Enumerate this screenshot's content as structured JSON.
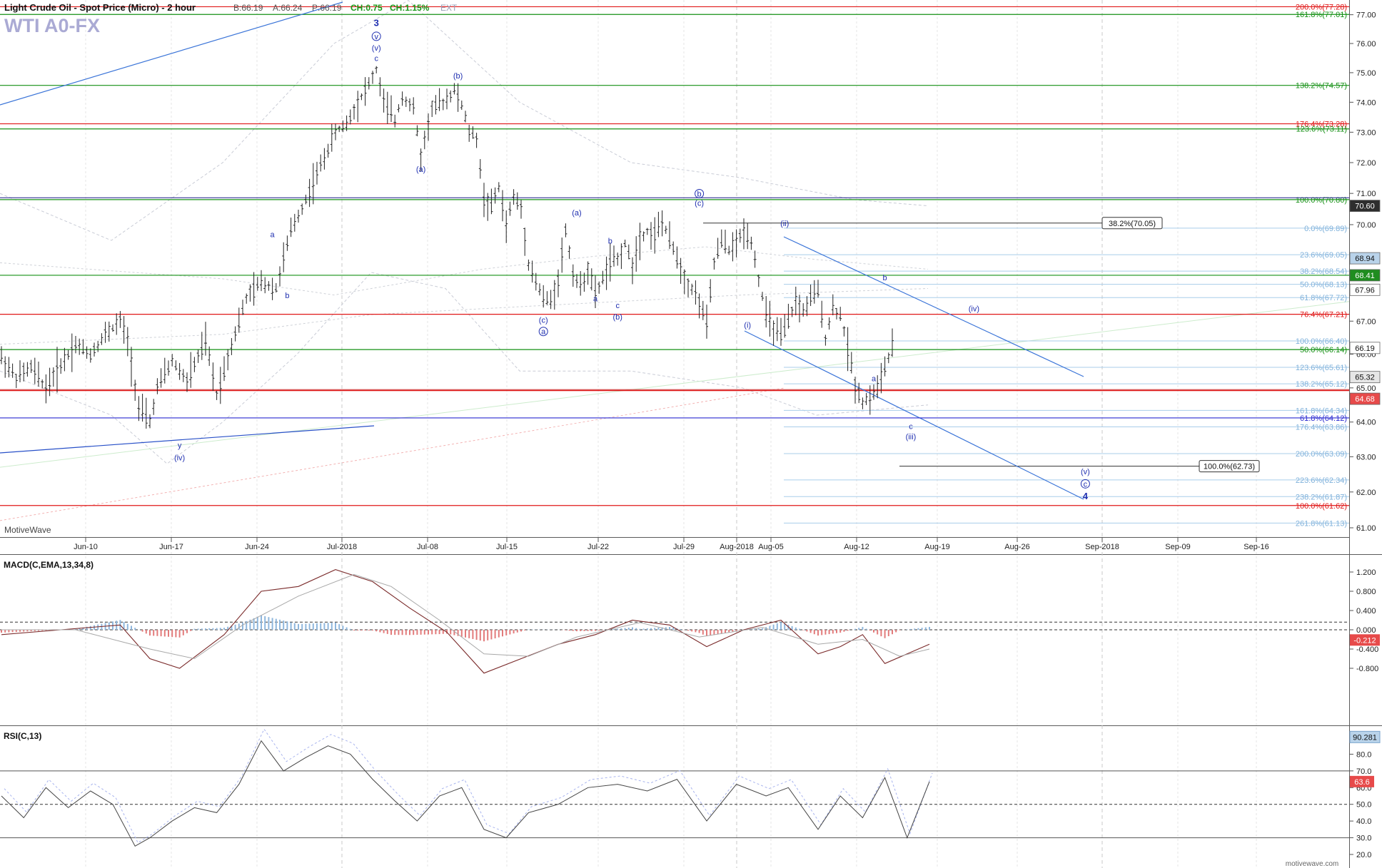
{
  "header": {
    "title": "Light Crude Oil - Spot Price (Micro) - 2 hour",
    "bid": "B:66.19",
    "ask": "A:66.24",
    "price": "P:66.19",
    "change": "CH:0.75",
    "change_pct": "CH:1.15%",
    "ext": "EXT",
    "symbol": "WTI A0-FX",
    "watermark": "MotiveWave",
    "footer_logo": "motivewave.com"
  },
  "colors": {
    "price_bars": "#222222",
    "up_text": "#1a9a1a",
    "wave_labels": "#1f2fb0",
    "fib_red": "#e01818",
    "fib_green": "#159015",
    "fib_lightblue": "#a9cdea",
    "trend_blue": "#3a74d8",
    "macd_hist_pos": "#8fb7dd",
    "macd_hist_neg": "#e27b7b"
  },
  "chart_data": [
    {
      "type": "candlestick",
      "title": "Light Crude Oil - Spot Price (Micro) - 2 hour",
      "x_tick_labels": [
        "Jun-10",
        "Jun-17",
        "Jun-24",
        "Jul-2018",
        "Jul-08",
        "Jul-15",
        "Jul-22",
        "Jul-29",
        "Aug-2018",
        "Aug-05",
        "Aug-12",
        "Aug-19",
        "Aug-26",
        "Sep-2018",
        "Sep-09",
        "Sep-16"
      ],
      "y_ticks": [
        "77.00",
        "76.00",
        "75.00",
        "74.00",
        "73.00",
        "72.00",
        "71.00",
        "70.00",
        "67.00",
        "66.00",
        "65.00",
        "64.00",
        "63.00",
        "62.00",
        "61.00"
      ],
      "ylim": [
        60.5,
        77.6
      ],
      "grid": true,
      "scale": "log",
      "price_path": [
        [
          0,
          65.9
        ],
        [
          4,
          65.3
        ],
        [
          8,
          65.6
        ],
        [
          12,
          65.0
        ],
        [
          16,
          65.7
        ],
        [
          20,
          66.3
        ],
        [
          24,
          66.0
        ],
        [
          28,
          66.6
        ],
        [
          32,
          67.0
        ],
        [
          34,
          66.4
        ],
        [
          37,
          64.4
        ],
        [
          40,
          64.0
        ],
        [
          42,
          65.0
        ],
        [
          46,
          65.8
        ],
        [
          50,
          65.2
        ],
        [
          55,
          66.4
        ],
        [
          58,
          64.8
        ],
        [
          62,
          66.3
        ],
        [
          66,
          67.7
        ],
        [
          70,
          68.2
        ],
        [
          74,
          68.0
        ],
        [
          78,
          69.8
        ],
        [
          82,
          70.8
        ],
        [
          86,
          71.9
        ],
        [
          90,
          73.0
        ],
        [
          93,
          73.3
        ],
        [
          96,
          74.0
        ],
        [
          99,
          74.6
        ],
        [
          101,
          75.1
        ],
        [
          103,
          74.0
        ],
        [
          106,
          73.4
        ],
        [
          108,
          74.2
        ],
        [
          111,
          73.8
        ],
        [
          113,
          72.2
        ],
        [
          116,
          73.8
        ],
        [
          119,
          74.0
        ],
        [
          122,
          74.4
        ],
        [
          124,
          73.9
        ],
        [
          126,
          73.0
        ],
        [
          128,
          72.8
        ],
        [
          130,
          70.8
        ],
        [
          132,
          70.6
        ],
        [
          134,
          71.2
        ],
        [
          136,
          70.0
        ],
        [
          138,
          70.9
        ],
        [
          140,
          70.5
        ],
        [
          142,
          68.8
        ],
        [
          144,
          68.2
        ],
        [
          146,
          67.7
        ],
        [
          148,
          67.6
        ],
        [
          150,
          68.3
        ],
        [
          152,
          69.8
        ],
        [
          154,
          68.5
        ],
        [
          156,
          68.0
        ],
        [
          158,
          68.6
        ],
        [
          160,
          67.8
        ],
        [
          162,
          68.3
        ],
        [
          164,
          68.8
        ],
        [
          166,
          68.9
        ],
        [
          168,
          69.4
        ],
        [
          170,
          68.7
        ],
        [
          172,
          69.6
        ],
        [
          174,
          69.8
        ],
        [
          176,
          69.7
        ],
        [
          178,
          70.1
        ],
        [
          180,
          69.5
        ],
        [
          182,
          69.0
        ],
        [
          184,
          68.3
        ],
        [
          186,
          68.0
        ],
        [
          188,
          67.6
        ],
        [
          190,
          66.9
        ],
        [
          192,
          68.8
        ],
        [
          194,
          69.5
        ],
        [
          196,
          69.2
        ],
        [
          198,
          69.4
        ],
        [
          200,
          69.8
        ],
        [
          202,
          69.5
        ],
        [
          204,
          68.3
        ],
        [
          206,
          67.2
        ],
        [
          208,
          66.8
        ],
        [
          210,
          66.5
        ],
        [
          212,
          67.0
        ],
        [
          214,
          67.6
        ],
        [
          216,
          67.3
        ],
        [
          218,
          67.7
        ],
        [
          220,
          67.9
        ],
        [
          222,
          66.5
        ],
        [
          224,
          67.4
        ],
        [
          226,
          67.2
        ],
        [
          228,
          66.2
        ],
        [
          230,
          65.1
        ],
        [
          232,
          64.6
        ],
        [
          234,
          64.7
        ],
        [
          236,
          65.0
        ],
        [
          238,
          65.6
        ],
        [
          240,
          66.19
        ]
      ],
      "wave_labels": [
        {
          "text": "3",
          "x": 101,
          "y": 76.6,
          "size": "large"
        },
        {
          "text": "v",
          "x": 101,
          "y": 76.15,
          "circled": true
        },
        {
          "text": "(v)",
          "x": 101,
          "y": 75.75
        },
        {
          "text": "c",
          "x": 101,
          "y": 75.4
        },
        {
          "text": "(b)",
          "x": 123,
          "y": 74.8
        },
        {
          "text": "(a)",
          "x": 113,
          "y": 71.7
        },
        {
          "text": "a",
          "x": 73,
          "y": 69.6
        },
        {
          "text": "b",
          "x": 77,
          "y": 67.7
        },
        {
          "text": "y",
          "x": 48,
          "y": 63.25
        },
        {
          "text": "(iv)",
          "x": 48,
          "y": 62.9
        },
        {
          "text": "(a)",
          "x": 155,
          "y": 70.3
        },
        {
          "text": "b",
          "x": 164,
          "y": 69.4
        },
        {
          "text": "a",
          "x": 160,
          "y": 67.6
        },
        {
          "text": "c",
          "x": 166,
          "y": 67.4
        },
        {
          "text": "(b)",
          "x": 166,
          "y": 67.05
        },
        {
          "text": "(c)",
          "x": 146,
          "y": 66.95
        },
        {
          "text": "a",
          "x": 146,
          "y": 66.6,
          "circled": true
        },
        {
          "text": "b",
          "x": 188,
          "y": 70.9,
          "circled": true
        },
        {
          "text": "(c)",
          "x": 188,
          "y": 70.6
        },
        {
          "text": "(ii)",
          "x": 211,
          "y": 69.95
        },
        {
          "text": "(i)",
          "x": 201,
          "y": 66.8
        },
        {
          "text": "b",
          "x": 238,
          "y": 68.25
        },
        {
          "text": "a",
          "x": 235,
          "y": 65.2
        },
        {
          "text": "(iv)",
          "x": 262,
          "y": 67.3
        },
        {
          "text": "c",
          "x": 245,
          "y": 63.8
        },
        {
          "text": "(iii)",
          "x": 245,
          "y": 63.5
        },
        {
          "text": "(v)",
          "x": 292,
          "y": 62.5
        },
        {
          "text": "c",
          "x": 292,
          "y": 62.15,
          "circled": true
        },
        {
          "text": "4",
          "x": 292,
          "y": 61.8,
          "size": "large"
        }
      ],
      "fib_levels": [
        {
          "price": 77.28,
          "label": "200.0%(77.28)",
          "color": "red"
        },
        {
          "price": 77.01,
          "label": "161.8%(77.01)",
          "color": "green"
        },
        {
          "price": 74.57,
          "label": "138.2%(74.57)",
          "color": "green"
        },
        {
          "price": 73.28,
          "label": "176.4%(73.28)",
          "color": "red"
        },
        {
          "price": 73.11,
          "label": "123.6%(73.11)",
          "color": "green"
        },
        {
          "price": 70.8,
          "label": "100.0%(70.80)",
          "color": "green"
        },
        {
          "price": 69.89,
          "label": "0.0%(69.89)",
          "color": "lightblue"
        },
        {
          "price": 69.05,
          "label": "23.6%(69.05)",
          "color": "lightblue"
        },
        {
          "price": 68.54,
          "label": "38.2%(68.54)",
          "color": "lightblue"
        },
        {
          "price": 68.41,
          "label": "",
          "color": "green"
        },
        {
          "price": 68.13,
          "label": "50.0%(68.13)",
          "color": "lightblue"
        },
        {
          "price": 67.72,
          "label": "61.8%(67.72)",
          "color": "lightblue"
        },
        {
          "price": 67.21,
          "label": "76.4%(67.21)",
          "color": "red"
        },
        {
          "price": 66.4,
          "label": "100.0%(66.40)",
          "color": "lightblue"
        },
        {
          "price": 66.14,
          "label": "50.0%(66.14)",
          "color": "green"
        },
        {
          "price": 65.61,
          "label": "123.6%(65.61)",
          "color": "lightblue"
        },
        {
          "price": 65.12,
          "label": "138.2%(65.12)",
          "color": "lightblue"
        },
        {
          "price": 64.92,
          "label": "",
          "color": "red"
        },
        {
          "price": 64.34,
          "label": "161.8%(64.34)",
          "color": "lightblue"
        },
        {
          "price": 64.12,
          "label": "61.8%(64.12)",
          "color": "blue"
        },
        {
          "price": 63.86,
          "label": "176.4%(63.86)",
          "color": "lightblue"
        },
        {
          "price": 63.09,
          "label": "200.0%(63.09)",
          "color": "lightblue"
        },
        {
          "price": 62.34,
          "label": "223.6%(62.34)",
          "color": "lightblue"
        },
        {
          "price": 61.87,
          "label": "238.2%(61.87)",
          "color": "lightblue"
        },
        {
          "price": 61.62,
          "label": "100.0%(61.62)",
          "color": "red"
        },
        {
          "price": 61.13,
          "label": "261.8%(61.13)",
          "color": "lightblue"
        }
      ],
      "boxed_labels": [
        {
          "text": "38.2%(70.05)",
          "price": 70.05
        },
        {
          "text": "100.0%(62.73)",
          "price": 62.73
        }
      ],
      "price_tags": [
        {
          "text": "70.60",
          "price": 70.6,
          "bg": "#2e2e2e",
          "fg": "#ffffff"
        },
        {
          "text": "68.94",
          "price": 68.94,
          "bg": "#b9d3ea",
          "fg": "#111111"
        },
        {
          "text": "68.41",
          "price": 68.41,
          "bg": "#1f8d1f",
          "fg": "#ffffff"
        },
        {
          "text": "67.96",
          "price": 67.96,
          "bg": "#ffffff",
          "fg": "#111111"
        },
        {
          "text": "66.19",
          "price": 66.19,
          "bg": "#ffffff",
          "fg": "#111111"
        },
        {
          "text": "65.32",
          "price": 65.32,
          "bg": "#e6e6e6",
          "fg": "#111111"
        },
        {
          "text": "64.68",
          "price": 64.68,
          "bg": "#e74a4a",
          "fg": "#ffffff"
        }
      ]
    },
    {
      "type": "bar",
      "title": "MACD(C,EMA,13,34,8)",
      "y_ticks": [
        "1.200",
        "0.800",
        "0.400",
        "0.000",
        "-0.400",
        "-0.800"
      ],
      "ylim": [
        -1.2,
        1.6
      ],
      "current_value": "-0.212",
      "macd_path": [
        [
          0,
          -0.1
        ],
        [
          16,
          0.0
        ],
        [
          32,
          0.1
        ],
        [
          40,
          -0.6
        ],
        [
          48,
          -0.8
        ],
        [
          60,
          -0.1
        ],
        [
          70,
          0.8
        ],
        [
          80,
          0.9
        ],
        [
          90,
          1.25
        ],
        [
          100,
          1.0
        ],
        [
          110,
          0.45
        ],
        [
          120,
          -0.05
        ],
        [
          130,
          -0.9
        ],
        [
          140,
          -0.6
        ],
        [
          150,
          -0.3
        ],
        [
          160,
          -0.1
        ],
        [
          170,
          0.2
        ],
        [
          180,
          0.1
        ],
        [
          190,
          -0.35
        ],
        [
          200,
          0.0
        ],
        [
          210,
          0.2
        ],
        [
          220,
          -0.5
        ],
        [
          226,
          -0.35
        ],
        [
          232,
          -0.1
        ],
        [
          238,
          -0.7
        ],
        [
          244,
          -0.5
        ],
        [
          250,
          -0.3
        ]
      ],
      "signal_path": [
        [
          0,
          0.0
        ],
        [
          20,
          0.0
        ],
        [
          40,
          -0.4
        ],
        [
          52,
          -0.6
        ],
        [
          65,
          0.1
        ],
        [
          80,
          0.7
        ],
        [
          95,
          1.15
        ],
        [
          105,
          0.9
        ],
        [
          118,
          0.2
        ],
        [
          130,
          -0.5
        ],
        [
          142,
          -0.55
        ],
        [
          155,
          -0.15
        ],
        [
          172,
          0.15
        ],
        [
          188,
          -0.15
        ],
        [
          205,
          0.05
        ],
        [
          220,
          -0.3
        ],
        [
          232,
          -0.2
        ],
        [
          242,
          -0.55
        ],
        [
          250,
          -0.4
        ]
      ]
    },
    {
      "type": "line",
      "title": "RSI(C,13)",
      "y_ticks": [
        "90.0",
        "80.0",
        "70.0",
        "60.0",
        "50.0",
        "40.0",
        "30.0",
        "20.0"
      ],
      "ylim": [
        15,
        95
      ],
      "current_value": "63.6",
      "top_tag": "90.281",
      "rsi_path": [
        [
          0,
          55
        ],
        [
          6,
          42
        ],
        [
          12,
          60
        ],
        [
          18,
          48
        ],
        [
          24,
          58
        ],
        [
          30,
          50
        ],
        [
          36,
          25
        ],
        [
          40,
          30
        ],
        [
          46,
          40
        ],
        [
          52,
          48
        ],
        [
          58,
          45
        ],
        [
          64,
          62
        ],
        [
          70,
          88
        ],
        [
          76,
          70
        ],
        [
          82,
          78
        ],
        [
          88,
          85
        ],
        [
          94,
          80
        ],
        [
          100,
          65
        ],
        [
          106,
          52
        ],
        [
          112,
          40
        ],
        [
          118,
          55
        ],
        [
          124,
          60
        ],
        [
          130,
          35
        ],
        [
          136,
          30
        ],
        [
          142,
          45
        ],
        [
          150,
          50
        ],
        [
          158,
          60
        ],
        [
          166,
          62
        ],
        [
          174,
          58
        ],
        [
          182,
          65
        ],
        [
          190,
          40
        ],
        [
          198,
          62
        ],
        [
          206,
          55
        ],
        [
          212,
          60
        ],
        [
          220,
          35
        ],
        [
          226,
          55
        ],
        [
          232,
          42
        ],
        [
          238,
          66
        ],
        [
          244,
          30
        ],
        [
          250,
          63.6
        ]
      ]
    }
  ]
}
